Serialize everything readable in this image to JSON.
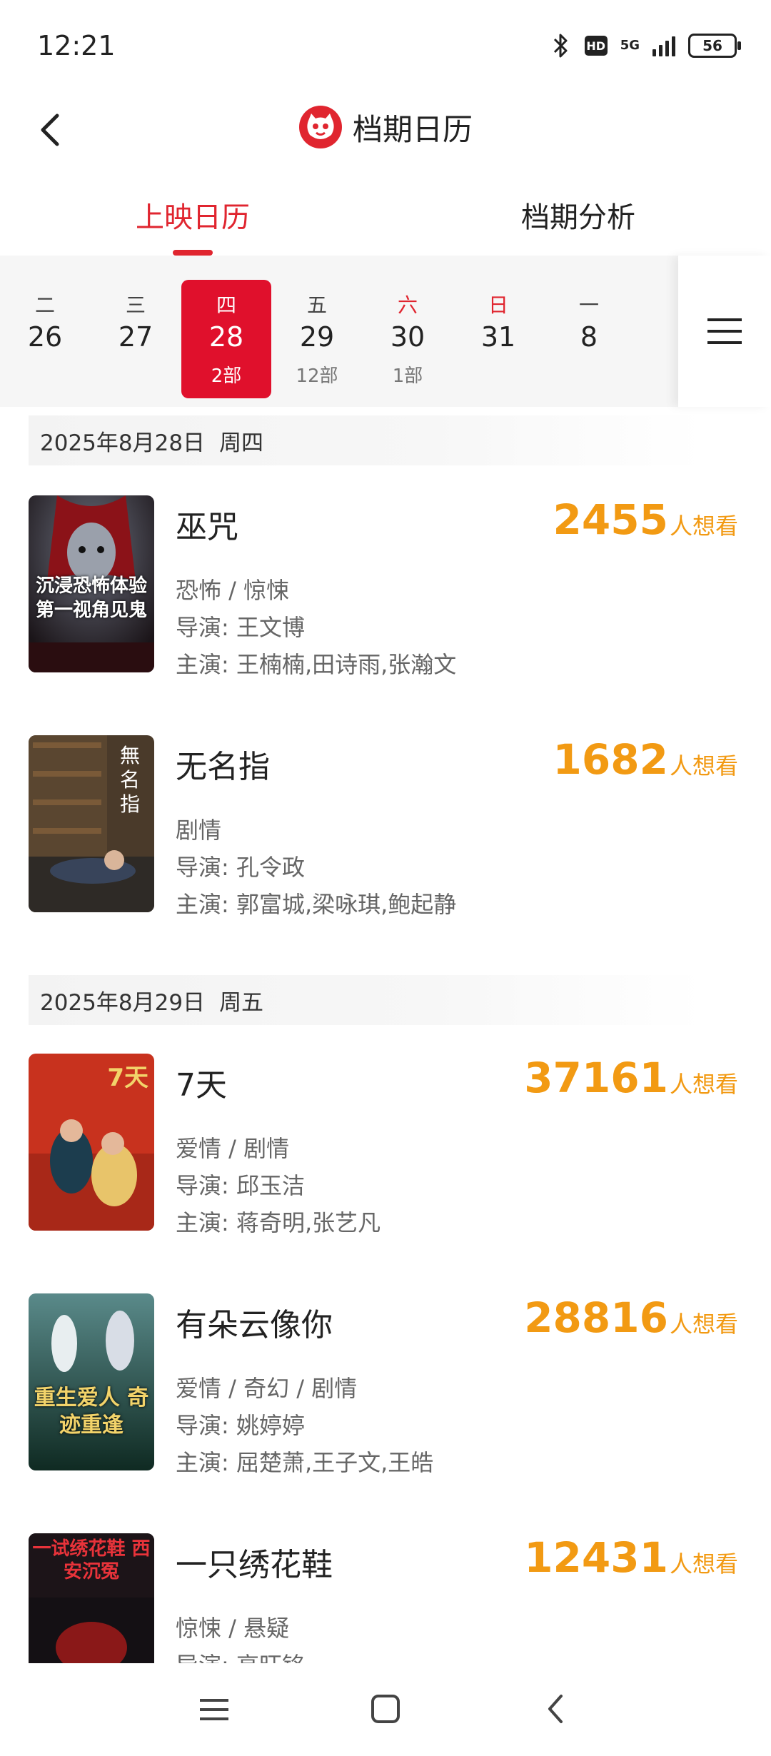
{
  "status_bar": {
    "time": "12:21",
    "network": "5G",
    "hd": "HD",
    "battery": "56"
  },
  "header": {
    "title": "档期日历"
  },
  "tabs": [
    {
      "label": "上映日历",
      "active": true
    },
    {
      "label": "档期分析",
      "active": false
    }
  ],
  "date_strip": [
    {
      "weekday": "二",
      "day": "26",
      "count": ""
    },
    {
      "weekday": "三",
      "day": "27",
      "count": ""
    },
    {
      "weekday": "四",
      "day": "28",
      "count": "2部",
      "selected": true
    },
    {
      "weekday": "五",
      "day": "29",
      "count": "12部"
    },
    {
      "weekday": "六",
      "day": "30",
      "count": "1部",
      "weekend": true
    },
    {
      "weekday": "日",
      "day": "31",
      "count": "",
      "weekend": true
    },
    {
      "weekday": "一",
      "day": "8",
      "count": ""
    }
  ],
  "sections": [
    {
      "date": "2025年8月28日",
      "weekday": "周四",
      "movies": [
        {
          "title": "巫咒",
          "want_count": "2455",
          "want_label": "人想看",
          "genre": "恐怖 / 惊悚",
          "director": "导演: 王文博",
          "cast": "主演: 王楠楠,田诗雨,张瀚文",
          "poster_text": "沉浸恐怖体验 第一视角见鬼"
        },
        {
          "title": "无名指",
          "want_count": "1682",
          "want_label": "人想看",
          "genre": "剧情",
          "director": "导演: 孔令政",
          "cast": "主演: 郭富城,梁咏琪,鲍起静",
          "poster_text": "無名指"
        }
      ]
    },
    {
      "date": "2025年8月29日",
      "weekday": "周五",
      "movies": [
        {
          "title": "7天",
          "want_count": "37161",
          "want_label": "人想看",
          "genre": "爱情 / 剧情",
          "director": "导演: 邱玉洁",
          "cast": "主演: 蒋奇明,张艺凡",
          "poster_text": "7天"
        },
        {
          "title": "有朵云像你",
          "want_count": "28816",
          "want_label": "人想看",
          "genre": "爱情 / 奇幻 / 剧情",
          "director": "导演: 姚婷婷",
          "cast": "主演: 屈楚萧,王子文,王皓",
          "poster_text": "重生爱人 奇迹重逢"
        },
        {
          "title": "一只绣花鞋",
          "want_count": "12431",
          "want_label": "人想看",
          "genre": "惊悚 / 悬疑",
          "director": "导演: 高旺铭",
          "cast": "",
          "poster_text": "一试绣花鞋 西安沉冤"
        }
      ]
    }
  ],
  "colors": {
    "accent": "#e0252f",
    "want": "#f29a13"
  }
}
